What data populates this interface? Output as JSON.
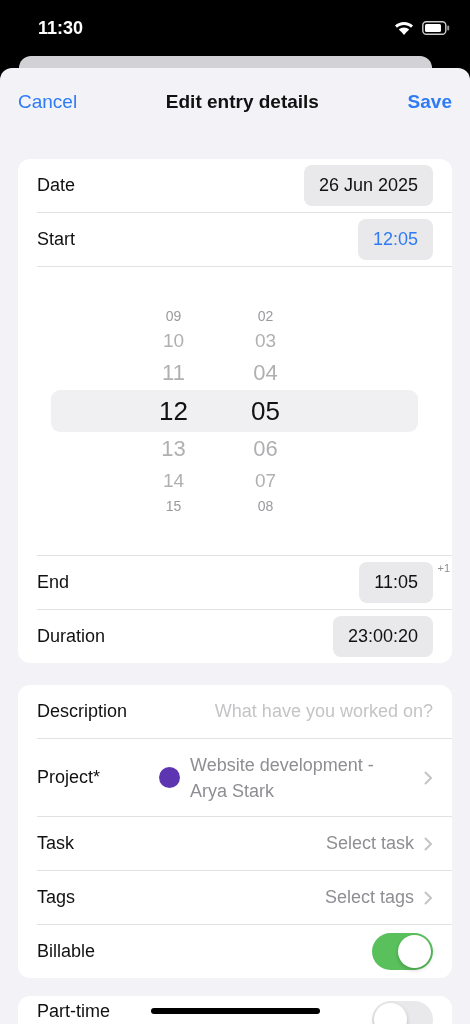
{
  "status_bar": {
    "time": "11:30"
  },
  "nav": {
    "cancel": "Cancel",
    "title": "Edit entry details",
    "save": "Save"
  },
  "time_section": [
    {
      "kind": "pill",
      "label": "Date",
      "value": "26 Jun 2025",
      "active": false
    },
    {
      "kind": "pill",
      "label": "Start",
      "value": "12:05",
      "active": true
    },
    {
      "kind": "picker",
      "columns": [
        {
          "items": [
            {
              "text": "09",
              "selected": false
            },
            {
              "text": "10",
              "selected": false
            },
            {
              "text": "11",
              "selected": false
            },
            {
              "text": "12",
              "selected": true
            },
            {
              "text": "13",
              "selected": false
            },
            {
              "text": "14",
              "selected": false
            },
            {
              "text": "15",
              "selected": false
            }
          ]
        },
        {
          "items": [
            {
              "text": "02",
              "selected": false
            },
            {
              "text": "03",
              "selected": false
            },
            {
              "text": "04",
              "selected": false
            },
            {
              "text": "05",
              "selected": true
            },
            {
              "text": "06",
              "selected": false
            },
            {
              "text": "07",
              "selected": false
            },
            {
              "text": "08",
              "selected": false
            }
          ]
        }
      ]
    },
    {
      "kind": "pill",
      "label": "End",
      "value": "11:05",
      "active": false,
      "note": "+1"
    },
    {
      "kind": "pill",
      "label": "Duration",
      "value": "23:00:20",
      "active": false
    }
  ],
  "details_section": [
    {
      "kind": "field",
      "label": "Description",
      "placeholder": "What have you worked on?"
    },
    {
      "kind": "link",
      "label": "Project*",
      "value": "Website development - Arya Stark",
      "color": "#5e35b1"
    },
    {
      "kind": "link",
      "label": "Task",
      "value": "Select task"
    },
    {
      "kind": "link",
      "label": "Tags",
      "value": "Select tags"
    },
    {
      "kind": "toggle",
      "label": "Billable",
      "on": true
    }
  ],
  "extra_section": [
    {
      "kind": "toggle",
      "label": "Part-time",
      "on": false
    }
  ]
}
